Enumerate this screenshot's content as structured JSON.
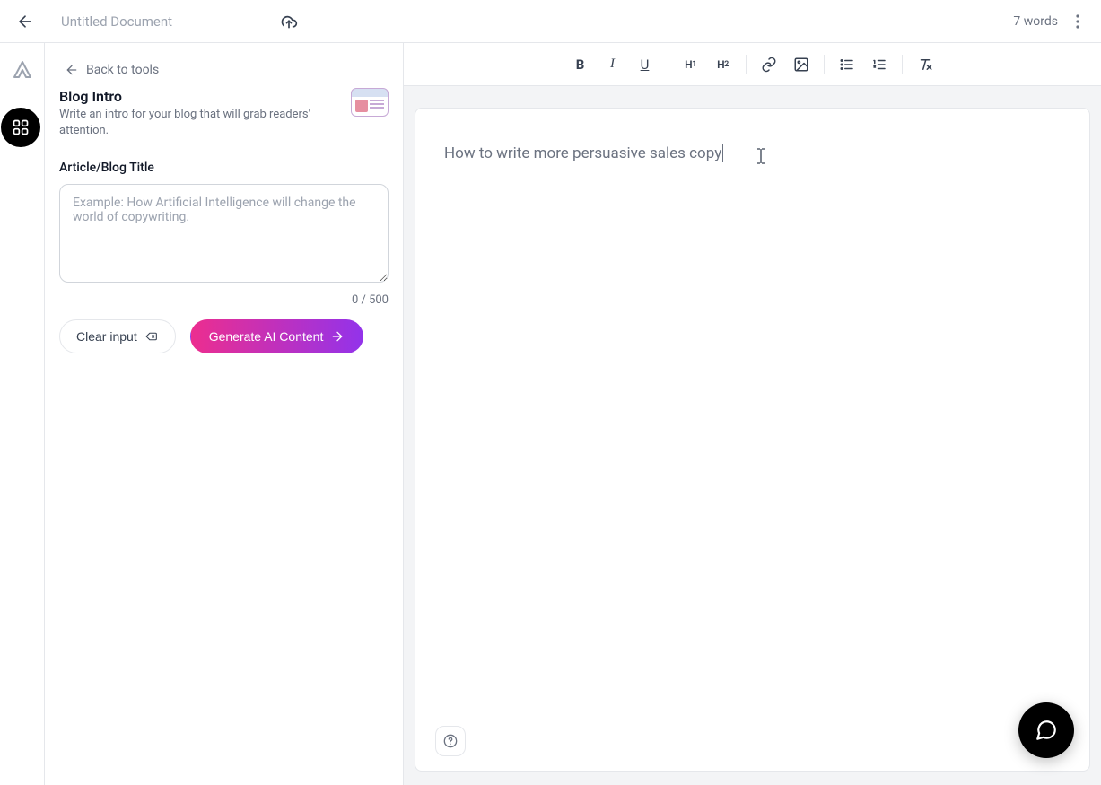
{
  "header": {
    "title": "Untitled Document",
    "word_count": "7 words"
  },
  "sidebar": {
    "back_to_tools": "Back to tools",
    "tool_name": "Blog Intro",
    "tool_desc": "Write an intro for your blog that will grab readers' attention.",
    "field_label": "Article/Blog Title",
    "placeholder": "Example: How Artificial Intelligence will change the world of copywriting.",
    "input_value": "",
    "char_counter": "0 / 500",
    "clear_label": "Clear input",
    "generate_label": "Generate AI Content"
  },
  "toolbar": {
    "bold": "B",
    "italic": "I",
    "underline": "U",
    "h1": "H1",
    "h2": "H2"
  },
  "editor": {
    "content": "How to write more persuasive sales copy"
  }
}
